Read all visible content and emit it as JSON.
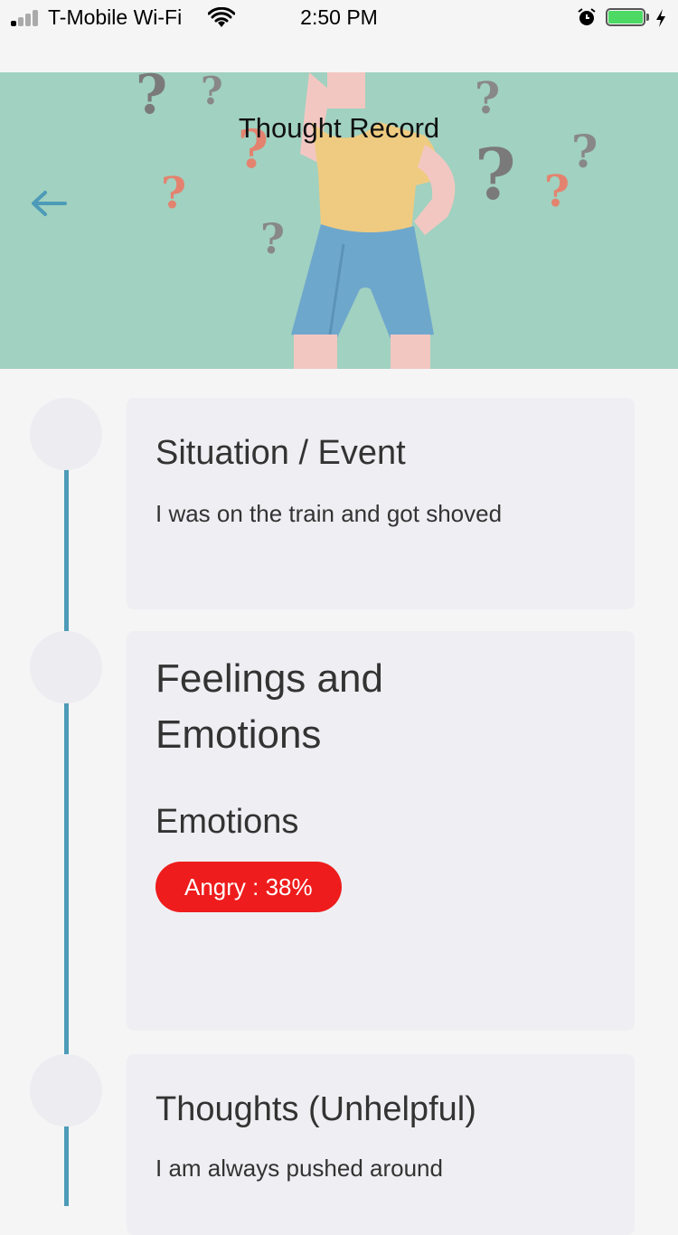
{
  "status_bar": {
    "carrier": "T-Mobile Wi-Fi",
    "time": "2:50 PM",
    "battery_level": 1.0
  },
  "header": {
    "title": "Thought Record",
    "back_icon": "arrow-left-icon",
    "background_color": "#a1d1c0"
  },
  "timeline": {
    "line_color": "#4d9bb8",
    "situation": {
      "title": "Situation / Event",
      "text": "I was on the train and got shoved"
    },
    "feelings": {
      "title_line1": "Feelings and",
      "title_line2": "Emotions",
      "subheading": "Emotions",
      "chip": {
        "label": "Angry : 38%",
        "color": "#ee1c1c"
      }
    },
    "thoughts": {
      "title": "Thoughts (Unhelpful)",
      "text": "I am always pushed around"
    }
  }
}
